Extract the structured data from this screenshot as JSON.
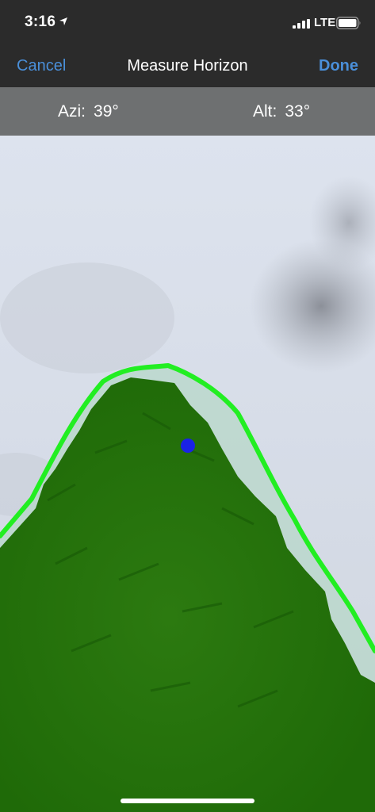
{
  "status_bar": {
    "time": "3:16",
    "network": "LTE",
    "icons": [
      "location-arrow-icon",
      "signal-bars-icon",
      "battery-icon"
    ]
  },
  "nav": {
    "cancel_label": "Cancel",
    "title": "Measure Horizon",
    "done_label": "Done"
  },
  "readout": {
    "azimuth_label": "Azi:",
    "azimuth_value": "39°",
    "altitude_label": "Alt:",
    "altitude_value": "33°"
  },
  "colors": {
    "bar_background": "#2b2b2b",
    "readout_background": "#6e7071",
    "accent_blue": "#4a8fd9",
    "horizon_line": "#22ee22",
    "marker": "#1a22e6"
  }
}
